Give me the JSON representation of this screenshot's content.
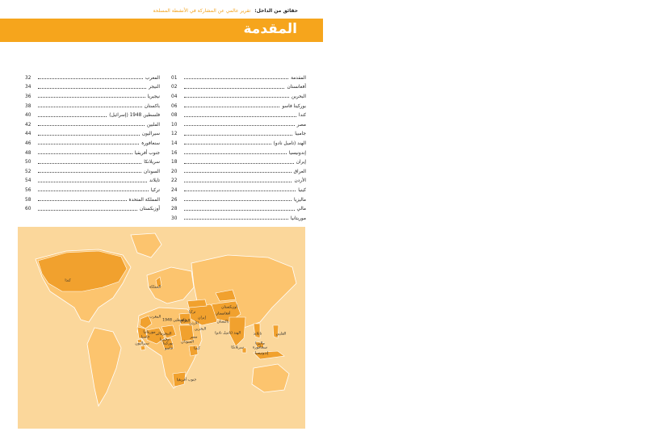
{
  "header": {
    "left": "حقائق من الداخل:",
    "right": "تقرير عالمي عن المشاركة في الأنشطة المسلحة"
  },
  "title": "المقدمة",
  "toc_right": [
    {
      "title": "المقدمة",
      "page": "01"
    },
    {
      "title": "أفغانستان",
      "page": "02"
    },
    {
      "title": "البحرين",
      "page": "04"
    },
    {
      "title": "بوركينا فاسو",
      "page": "06"
    },
    {
      "title": "كندا",
      "page": "08"
    },
    {
      "title": "مصر",
      "page": "10"
    },
    {
      "title": "جامبيا",
      "page": "12"
    },
    {
      "title": "الهند (تاميل نادو)",
      "page": "14"
    },
    {
      "title": "إندونيسيا",
      "page": "16"
    },
    {
      "title": "إيران",
      "page": "18"
    },
    {
      "title": "العراق",
      "page": "20"
    },
    {
      "title": "الأردن",
      "page": "22"
    },
    {
      "title": "كينيا",
      "page": "24"
    },
    {
      "title": "ماليزيا",
      "page": "26"
    },
    {
      "title": "مالي",
      "page": "28"
    },
    {
      "title": "موريتانيا",
      "page": "30"
    }
  ],
  "toc_left": [
    {
      "title": "المغرب",
      "page": "32"
    },
    {
      "title": "النيجر",
      "page": "34"
    },
    {
      "title": "نيجيريا",
      "page": "36"
    },
    {
      "title": "باكستان",
      "page": "38"
    },
    {
      "title": "فلسطين 1948 (إسرائيل)",
      "page": "40"
    },
    {
      "title": "الفلبين",
      "page": "42"
    },
    {
      "title": "سيراليون",
      "page": "44"
    },
    {
      "title": "سنغافورة",
      "page": "46"
    },
    {
      "title": "جنوب أفريقيا",
      "page": "48"
    },
    {
      "title": "سريلانكا",
      "page": "50"
    },
    {
      "title": "السودان",
      "page": "52"
    },
    {
      "title": "تايلاند",
      "page": "54"
    },
    {
      "title": "تركيا",
      "page": "56"
    },
    {
      "title": "المملكة المتحدة",
      "page": "58"
    },
    {
      "title": "أوزبكستان",
      "page": "60"
    }
  ],
  "map_labels": [
    "كندا",
    "المملكة",
    "المغرب",
    "أوزبكستان",
    "تركيا",
    "أفغانستان",
    "باكستان",
    "إيران",
    "العراق",
    "فلسطين 1948",
    "الأردن",
    "البحرين",
    "مصر",
    "الهند (تاميل نادو)",
    "تايلاند",
    "الفلبين",
    "ماليزيا",
    "سنغافورة",
    "إندونيسيا",
    "سريلانكا",
    "موريتانيا",
    "مالي",
    "النيجر",
    "جامبيا",
    "نيجيريا",
    "سيراليون",
    "بوركينا",
    "فاسو",
    "السودان",
    "كينيا",
    "جنوب أفريقيا"
  ],
  "colors": {
    "accent": "#f6a51c",
    "map_background": "#fbd79b",
    "map_land": "#fcc46e",
    "map_highlight": "#f1a12e"
  }
}
